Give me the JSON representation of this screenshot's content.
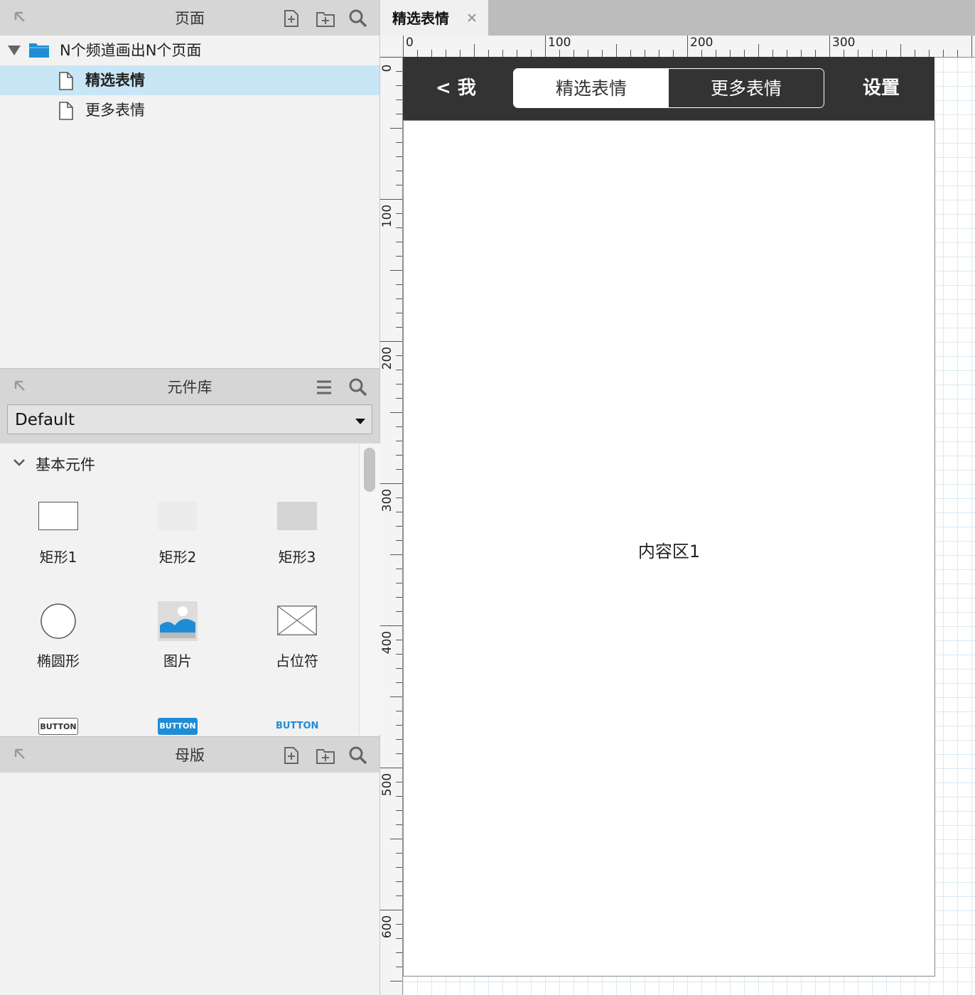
{
  "pages_panel": {
    "title": "页面",
    "folder": "N个频道画出N个页面",
    "items": [
      "精选表情",
      "更多表情"
    ]
  },
  "library_panel": {
    "title": "元件库",
    "selected_library": "Default",
    "section": "基本元件",
    "items": [
      "矩形1",
      "矩形2",
      "矩形3",
      "椭圆形",
      "图片",
      "占位符"
    ],
    "buttons": [
      "BUTTON",
      "BUTTON",
      "BUTTON"
    ]
  },
  "masters_panel": {
    "title": "母版"
  },
  "editor": {
    "tab_title": "精选表情",
    "h_ruler": [
      "0",
      "100",
      "200",
      "300"
    ],
    "v_ruler": [
      "0",
      "100",
      "200",
      "300",
      "400",
      "500",
      "600"
    ]
  },
  "mockup": {
    "back_label": "< 我",
    "segments": [
      "精选表情",
      "更多表情"
    ],
    "settings_label": "设置",
    "content_label": "内容区1"
  },
  "colors": {
    "accent": "#1f8dd6",
    "selection": "#c8e6f5",
    "nav_bg": "#333333"
  }
}
